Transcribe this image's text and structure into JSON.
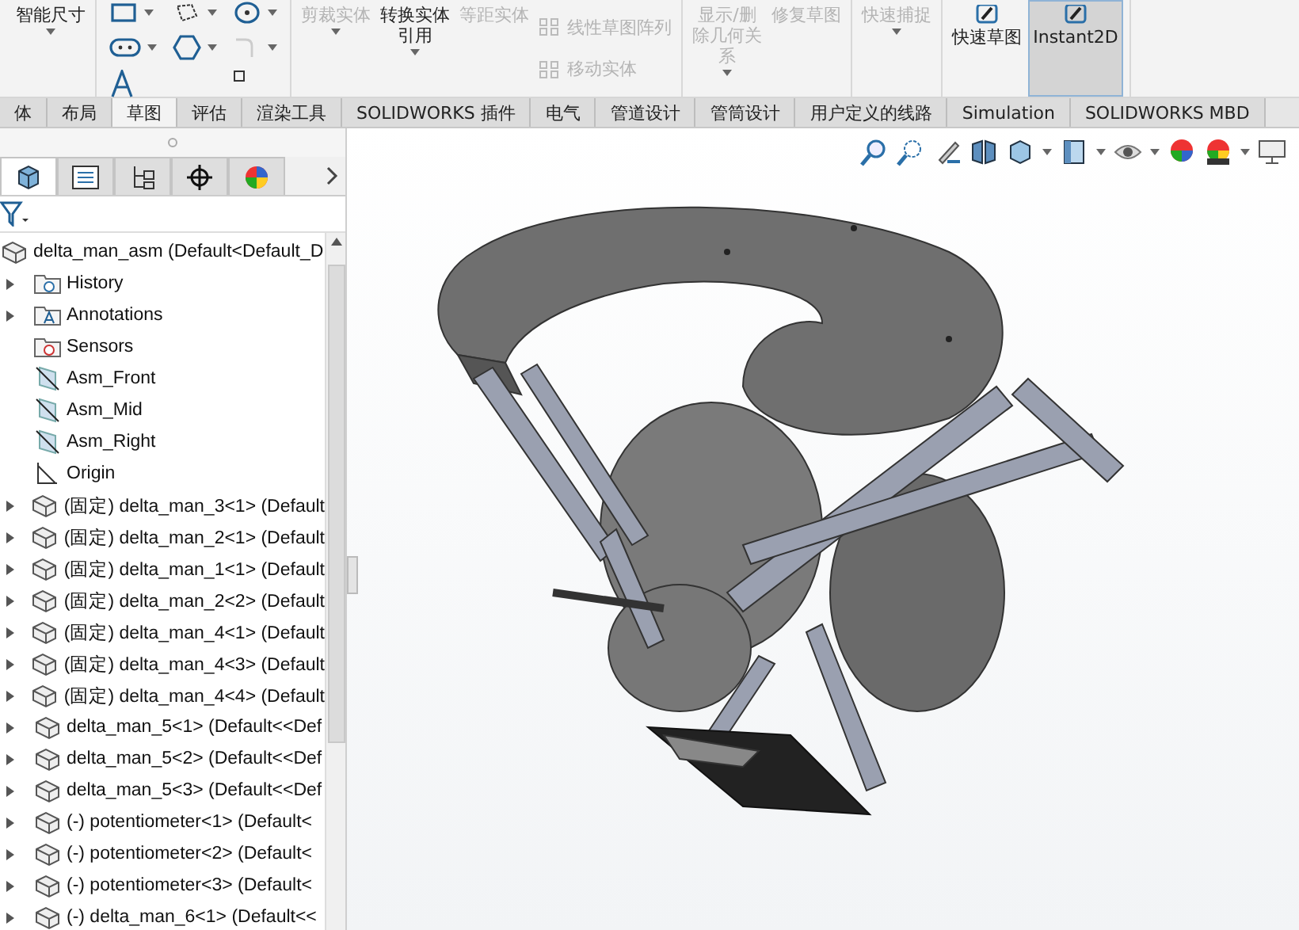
{
  "ribbon": {
    "sections": [
      {
        "items": [
          {
            "kind": "large",
            "label": "智能尺寸",
            "disabled": false,
            "selected": false,
            "caret": true
          }
        ]
      },
      {
        "items": [
          {
            "kind": "icon-grid"
          }
        ]
      },
      {
        "items": [
          {
            "kind": "large",
            "label": "剪裁实体",
            "disabled": true,
            "selected": false,
            "caret": true
          },
          {
            "kind": "large",
            "label": "转换实体引用",
            "disabled": false,
            "selected": false,
            "caret": true
          },
          {
            "kind": "large",
            "label": "等距实体",
            "disabled": true,
            "selected": false,
            "caret": false
          },
          {
            "kind": "small-list",
            "entries": [
              {
                "label": "线性草图阵列",
                "disabled": true
              },
              {
                "label": "移动实体",
                "disabled": true
              }
            ]
          }
        ]
      },
      {
        "items": [
          {
            "kind": "large",
            "label": "显示/删除几何关系",
            "disabled": true,
            "selected": false,
            "caret": true
          },
          {
            "kind": "large",
            "label": "修复草图",
            "disabled": true,
            "selected": false,
            "caret": false
          }
        ]
      },
      {
        "items": [
          {
            "kind": "large",
            "label": "快速捕捉",
            "disabled": true,
            "selected": false,
            "caret": true
          }
        ]
      },
      {
        "items": [
          {
            "kind": "large",
            "label": "快速草图",
            "disabled": false,
            "selected": false,
            "caret": false
          },
          {
            "kind": "large",
            "label": "Instant2D",
            "disabled": false,
            "selected": true,
            "caret": false
          }
        ]
      }
    ]
  },
  "tabs": [
    {
      "label": "体",
      "selected": false
    },
    {
      "label": "布局",
      "selected": false
    },
    {
      "label": "草图",
      "selected": true
    },
    {
      "label": "评估",
      "selected": false
    },
    {
      "label": "渲染工具",
      "selected": false
    },
    {
      "label": "SOLIDWORKS 插件",
      "selected": false
    },
    {
      "label": "电气",
      "selected": false
    },
    {
      "label": "管道设计",
      "selected": false
    },
    {
      "label": "管筒设计",
      "selected": false
    },
    {
      "label": "用户定义的线路",
      "selected": false
    },
    {
      "label": "Simulation",
      "selected": false
    },
    {
      "label": "SOLIDWORKS MBD",
      "selected": false
    }
  ],
  "panel_tabs": [
    {
      "kind": "feature",
      "selected": true
    },
    {
      "kind": "property",
      "selected": false
    },
    {
      "kind": "config",
      "selected": false
    },
    {
      "kind": "dim",
      "selected": false
    },
    {
      "kind": "display",
      "selected": false
    }
  ],
  "tree": {
    "label": "delta_man_asm  (Default<Default_D",
    "children": [
      {
        "kind": "history",
        "label": "History",
        "expandable": true
      },
      {
        "kind": "annotations",
        "label": "Annotations",
        "expandable": true
      },
      {
        "kind": "sensors",
        "label": "Sensors",
        "expandable": false
      },
      {
        "kind": "plane",
        "label": "Asm_Front",
        "expandable": false
      },
      {
        "kind": "plane",
        "label": "Asm_Mid",
        "expandable": false
      },
      {
        "kind": "plane",
        "label": "Asm_Right",
        "expandable": false
      },
      {
        "kind": "origin",
        "label": "Origin",
        "expandable": false
      },
      {
        "kind": "part",
        "label": "(固定) delta_man_3<1> (Default",
        "expandable": true
      },
      {
        "kind": "part",
        "label": "(固定) delta_man_2<1> (Default",
        "expandable": true
      },
      {
        "kind": "part",
        "label": "(固定) delta_man_1<1> (Default",
        "expandable": true
      },
      {
        "kind": "part",
        "label": "(固定) delta_man_2<2> (Default",
        "expandable": true
      },
      {
        "kind": "part",
        "label": "(固定) delta_man_4<1> (Default",
        "expandable": true
      },
      {
        "kind": "part",
        "label": "(固定) delta_man_4<3> (Default",
        "expandable": true
      },
      {
        "kind": "part",
        "label": "(固定) delta_man_4<4> (Default",
        "expandable": true
      },
      {
        "kind": "part",
        "label": "delta_man_5<1> (Default<<Def",
        "expandable": true
      },
      {
        "kind": "part",
        "label": "delta_man_5<2> (Default<<Def",
        "expandable": true
      },
      {
        "kind": "part",
        "label": "delta_man_5<3> (Default<<Def",
        "expandable": true
      },
      {
        "kind": "part",
        "label": "(-) potentiometer<1> (Default<",
        "expandable": true
      },
      {
        "kind": "part",
        "label": "(-) potentiometer<2> (Default<",
        "expandable": true
      },
      {
        "kind": "part",
        "label": "(-) potentiometer<3> (Default<",
        "expandable": true
      },
      {
        "kind": "part",
        "label": "(-) delta_man_6<1> (Default<<",
        "expandable": true
      }
    ]
  }
}
